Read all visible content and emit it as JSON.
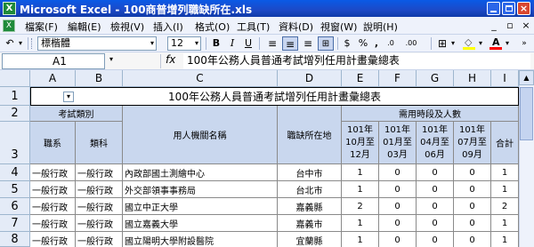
{
  "window": {
    "title": "Microsoft Excel - 100商普增列職缺所在.xls"
  },
  "menu": {
    "items": [
      "檔案(F)",
      "編輯(E)",
      "檢視(V)",
      "插入(I)",
      "格式(O)",
      "工具(T)",
      "資料(D)",
      "視窗(W)",
      "說明(H)"
    ]
  },
  "toolbar": {
    "font_name": "標楷體",
    "font_size": "12",
    "bold_label": "B",
    "italic_label": "I",
    "underline_label": "U",
    "currency_label": "$",
    "percent_label": "%",
    "comma_label": ",",
    "increase_decimal_label": ".0",
    "decrease_decimal_label": ".00"
  },
  "formula_bar": {
    "name_box": "A1",
    "fx_label": "fx",
    "content": "100年公務人員普通考試增列任用計畫彙總表"
  },
  "grid": {
    "columns": [
      "A",
      "B",
      "C",
      "D",
      "E",
      "F",
      "G",
      "H",
      "I"
    ],
    "rows": [
      "1",
      "2",
      "3",
      "4",
      "5",
      "6",
      "7",
      "8"
    ],
    "title": "100年公務人員普通考試增列任用計畫彙總表",
    "header": {
      "exam_category": "考試類別",
      "department": "職系",
      "subject": "類科",
      "agency_name": "用人機關名稱",
      "location": "職缺所在地",
      "period_group": "需用時段及人數",
      "periods": [
        "101年10月至12月",
        "101年01月至03月",
        "101年04月至06月",
        "101年07月至09月"
      ],
      "total": "合計"
    },
    "data_rows": [
      {
        "department": "一般行政",
        "subject": "一般行政",
        "agency": "內政部國土測繪中心",
        "location": "台中市",
        "q1": "1",
        "q2": "0",
        "q3": "0",
        "q4": "0",
        "total": "1"
      },
      {
        "department": "一般行政",
        "subject": "一般行政",
        "agency": "外交部領事事務局",
        "location": "台北市",
        "q1": "1",
        "q2": "0",
        "q3": "0",
        "q4": "0",
        "total": "1"
      },
      {
        "department": "一般行政",
        "subject": "一般行政",
        "agency": "國立中正大學",
        "location": "嘉義縣",
        "q1": "2",
        "q2": "0",
        "q3": "0",
        "q4": "0",
        "total": "2"
      },
      {
        "department": "一般行政",
        "subject": "一般行政",
        "agency": "國立嘉義大學",
        "location": "嘉義市",
        "q1": "1",
        "q2": "0",
        "q3": "0",
        "q4": "0",
        "total": "1"
      },
      {
        "department": "一般行政",
        "subject": "一般行政",
        "agency": "國立陽明大學附設醫院",
        "location": "宜蘭縣",
        "q1": "1",
        "q2": "0",
        "q3": "0",
        "q4": "0",
        "total": "1"
      }
    ]
  }
}
